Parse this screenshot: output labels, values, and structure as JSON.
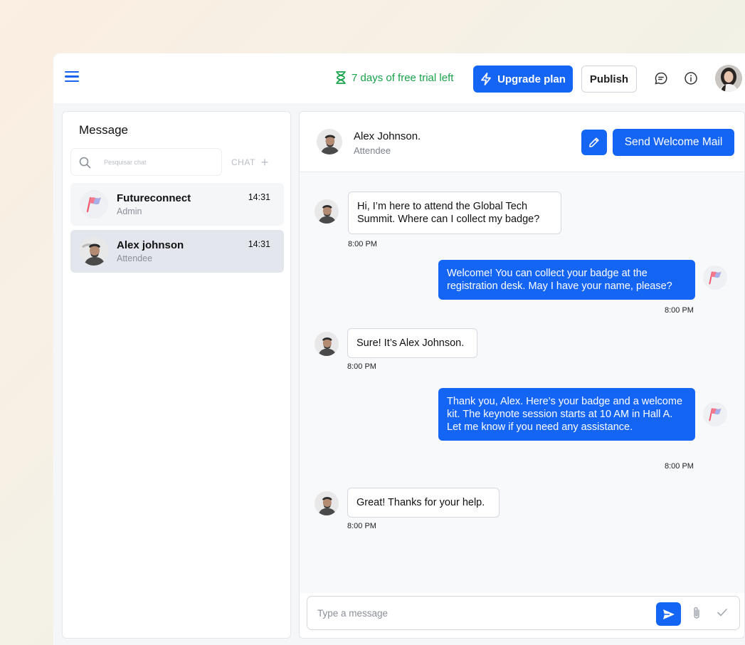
{
  "header": {
    "trial_text": "7 days of free trial left",
    "upgrade_label": "Upgrade plan",
    "publish_label": "Publish"
  },
  "colors": {
    "accent": "#1565f5",
    "trial": "#17a34a"
  },
  "sidebar": {
    "title": "Message",
    "search_placeholder": "Pesquisar chat",
    "chat_label": "CHAT",
    "conversations": [
      {
        "name": "Futureconnect",
        "role": "Admin",
        "time": "14:31",
        "avatar": "flag-icon"
      },
      {
        "name": "Alex johnson",
        "role": "Attendee",
        "time": "14:31",
        "avatar": "user-photo",
        "active": true
      }
    ]
  },
  "chat": {
    "contact_name": "Alex Johnson.",
    "contact_role": "Attendee",
    "send_welcome_label": "Send Welcome Mail",
    "messages": [
      {
        "from": "in",
        "text": "Hi, I’m here to attend the Global Tech Summit. Where can I collect my badge?",
        "time": "8:00 PM"
      },
      {
        "from": "out",
        "text": "Welcome! You can collect your badge at the registration desk. May I have your name, please?",
        "time": "8:00 PM"
      },
      {
        "from": "in",
        "text": "Sure! It’s Alex Johnson.",
        "time": "8:00 PM"
      },
      {
        "from": "out",
        "text": "Thank you, Alex. Here’s your badge and a welcome kit. The keynote session starts at 10 AM in Hall A. Let me know if you need any assistance.",
        "time": "8:00 PM"
      },
      {
        "from": "in",
        "text": "Great! Thanks for your help.",
        "time": "8:00 PM"
      }
    ],
    "composer_placeholder": "Type a message"
  }
}
